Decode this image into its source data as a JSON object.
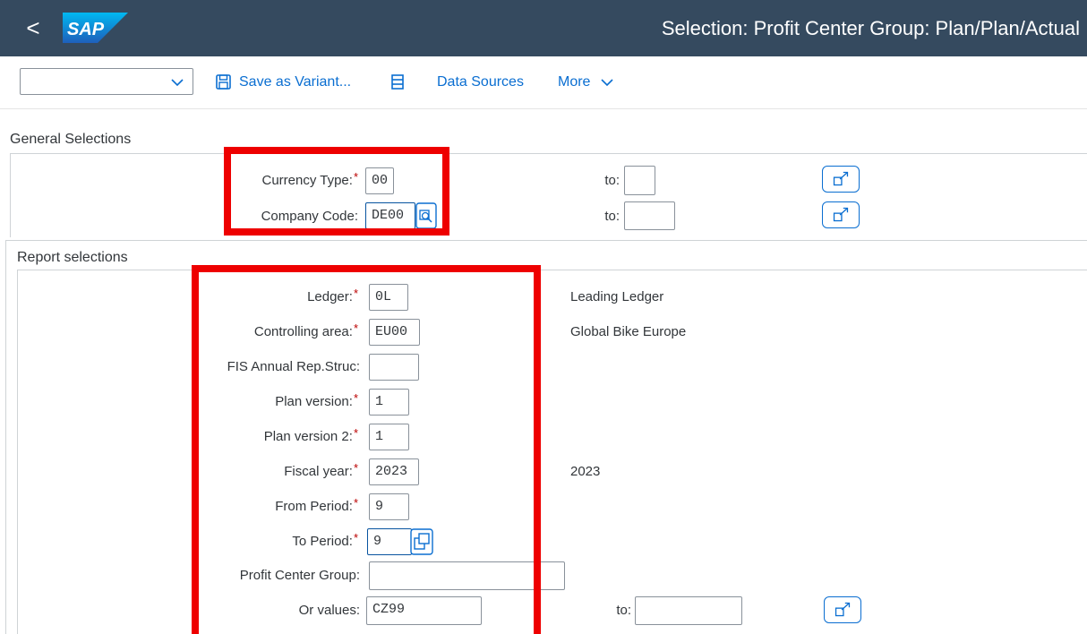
{
  "shell": {
    "back_label": "<",
    "logo_text": "SAP",
    "title": "Selection: Profit Center Group: Plan/Plan/Actual"
  },
  "toolbar": {
    "variant_value": "",
    "save_variant_label": "Save as Variant...",
    "data_sources_label": "Data Sources",
    "more_label": "More"
  },
  "general_selections": {
    "title": "General Selections",
    "currency_type": {
      "label": "Currency Type:",
      "value": "00",
      "to_label": "to:",
      "to_value": ""
    },
    "company_code": {
      "label": "Company Code:",
      "value": "DE00",
      "to_label": "to:",
      "to_value": ""
    }
  },
  "report_selections": {
    "title": "Report selections",
    "ledger": {
      "label": "Ledger:",
      "value": "0L",
      "description": "Leading Ledger"
    },
    "controlling_area": {
      "label": "Controlling area:",
      "value": "EU00",
      "description": "Global Bike Europe"
    },
    "fis_annual": {
      "label": "FIS Annual Rep.Struc:",
      "value": ""
    },
    "plan_version": {
      "label": "Plan version:",
      "value": "1"
    },
    "plan_version_2": {
      "label": "Plan version 2:",
      "value": "1"
    },
    "fiscal_year": {
      "label": "Fiscal year:",
      "value": "2023",
      "description": "2023"
    },
    "from_period": {
      "label": "From Period:",
      "value": "9"
    },
    "to_period": {
      "label": "To Period:",
      "value": "9"
    },
    "profit_center_group": {
      "label": "Profit Center Group:",
      "value": ""
    },
    "or_values": {
      "label": "Or values:",
      "value": "CZ99",
      "to_label": "to:",
      "to_value": ""
    }
  },
  "colors": {
    "shell": "#354a5f",
    "accent": "#0a6ed1",
    "required": "#bb0000",
    "highlight": "#ee0000"
  }
}
